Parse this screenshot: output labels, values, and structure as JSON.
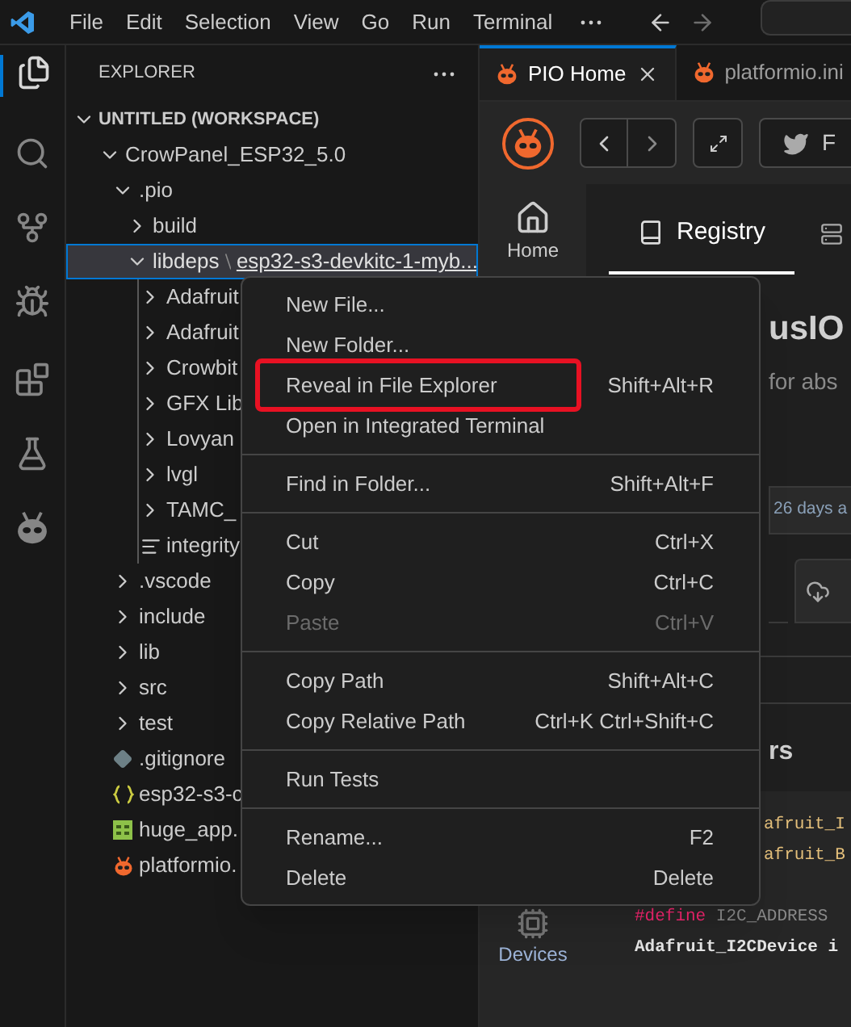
{
  "menu_bar": [
    "File",
    "Edit",
    "Selection",
    "View",
    "Go",
    "Run",
    "Terminal"
  ],
  "sidebar": {
    "title": "EXPLORER",
    "workspace": {
      "label": "UNTITLED (WORKSPACE)",
      "expanded": true
    },
    "tree": [
      {
        "label": "CrowPanel_ESP32_5.0",
        "kind": "folder",
        "expanded": true,
        "selected": false,
        "children": [
          {
            "label": ".pio",
            "kind": "folder",
            "expanded": true,
            "selected": false,
            "children": [
              {
                "label": "build",
                "kind": "folder",
                "expanded": false,
                "selected": false
              },
              {
                "label": "libdeps",
                "compact_label": "esp32-s3-devkitc-1-myb...",
                "kind": "folder",
                "expanded": true,
                "selected": true,
                "children": [
                  {
                    "label": "Adafruit",
                    "kind": "folder",
                    "expanded": false,
                    "selected": false
                  },
                  {
                    "label": "Adafruit",
                    "kind": "folder",
                    "expanded": false,
                    "selected": false
                  },
                  {
                    "label": "Crowbit",
                    "kind": "folder",
                    "expanded": false,
                    "selected": false
                  },
                  {
                    "label": "GFX Lib",
                    "kind": "folder",
                    "expanded": false,
                    "selected": false
                  },
                  {
                    "label": "Lovyan",
                    "kind": "folder",
                    "expanded": false,
                    "selected": false
                  },
                  {
                    "label": "lvgl",
                    "kind": "folder",
                    "expanded": false,
                    "selected": false
                  },
                  {
                    "label": "TAMC_",
                    "kind": "folder",
                    "expanded": false,
                    "selected": false
                  },
                  {
                    "label": "integrity",
                    "kind": "textfile",
                    "selected": false
                  }
                ]
              }
            ]
          },
          {
            "label": ".vscode",
            "kind": "folder",
            "expanded": false,
            "selected": false
          },
          {
            "label": "include",
            "kind": "folder",
            "expanded": false,
            "selected": false
          },
          {
            "label": "lib",
            "kind": "folder",
            "expanded": false,
            "selected": false
          },
          {
            "label": "src",
            "kind": "folder",
            "expanded": false,
            "selected": false
          },
          {
            "label": "test",
            "kind": "folder",
            "expanded": false,
            "selected": false
          },
          {
            "label": ".gitignore",
            "kind": "gitfile",
            "selected": false
          },
          {
            "label": "esp32-s3-c",
            "kind": "jsonfile",
            "selected": false
          },
          {
            "label": "huge_app.",
            "kind": "sheetfile",
            "selected": false
          },
          {
            "label": "platformio.",
            "kind": "piofile",
            "selected": false
          }
        ]
      }
    ]
  },
  "tabs": [
    {
      "label": "PIO Home",
      "selected": true
    },
    {
      "label": "platformio.ini",
      "selected": false
    }
  ],
  "pio": {
    "follow_fragment": "F",
    "nav": [
      "Home",
      "Devices"
    ],
    "subtabs": [
      {
        "label": "Registry",
        "selected": true
      }
    ],
    "title_fragment": "usIO",
    "subtitle_fragment": "for abs",
    "updated_fragment": "26 days a",
    "section_fragment": "rs",
    "code_lines": [
      [
        {
          "kind": "type",
          "text": "afruit_I"
        }
      ],
      [
        {
          "kind": "type",
          "text": "afruit_B"
        }
      ],
      [
        {
          "kind": "keyword",
          "text": "#define"
        },
        {
          "kind": "plain",
          "text": " I2C_ADDRESS"
        }
      ],
      [
        {
          "kind": "bold",
          "text": "Adafruit_I2CDevice i"
        }
      ]
    ]
  },
  "context_menu": [
    [
      {
        "label": "New File...",
        "disabled": false,
        "highlighted": false
      },
      {
        "label": "New Folder...",
        "disabled": false,
        "highlighted": false
      },
      {
        "label": "Reveal in File Explorer",
        "shortcut": "Shift+Alt+R",
        "disabled": false,
        "highlighted": true
      },
      {
        "label": "Open in Integrated Terminal",
        "disabled": false,
        "highlighted": false
      }
    ],
    [
      {
        "label": "Find in Folder...",
        "shortcut": "Shift+Alt+F",
        "disabled": false,
        "highlighted": false
      }
    ],
    [
      {
        "label": "Cut",
        "shortcut": "Ctrl+X",
        "disabled": false,
        "highlighted": false
      },
      {
        "label": "Copy",
        "shortcut": "Ctrl+C",
        "disabled": false,
        "highlighted": false
      },
      {
        "label": "Paste",
        "shortcut": "Ctrl+V",
        "disabled": true,
        "highlighted": false
      }
    ],
    [
      {
        "label": "Copy Path",
        "shortcut": "Shift+Alt+C",
        "disabled": false,
        "highlighted": false
      },
      {
        "label": "Copy Relative Path",
        "shortcut": "Ctrl+K Ctrl+Shift+C",
        "disabled": false,
        "highlighted": false
      }
    ],
    [
      {
        "label": "Run Tests",
        "disabled": false,
        "highlighted": false
      }
    ],
    [
      {
        "label": "Rename...",
        "shortcut": "F2",
        "disabled": false,
        "highlighted": false
      },
      {
        "label": "Delete",
        "shortcut": "Delete",
        "disabled": false,
        "highlighted": false
      }
    ]
  ]
}
